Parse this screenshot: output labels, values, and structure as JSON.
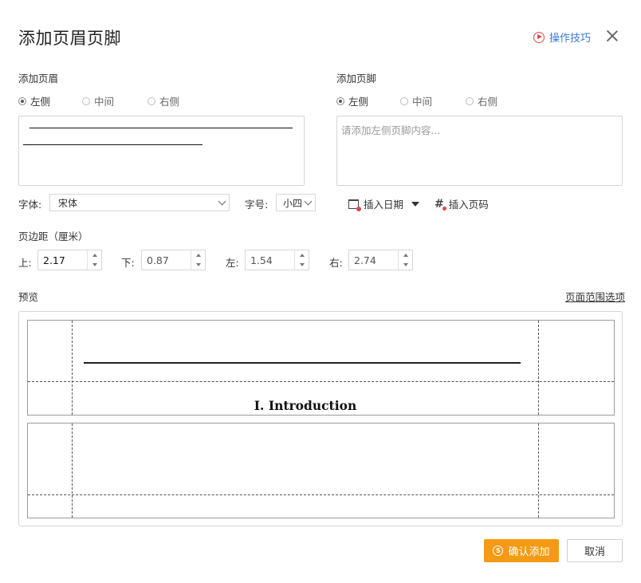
{
  "dialog": {
    "title": "添加页眉页脚",
    "tips_label": "操作技巧"
  },
  "header_section": {
    "label": "添加页眉",
    "positions": [
      "左侧",
      "中间",
      "右侧"
    ],
    "selected": "左侧"
  },
  "footer_section": {
    "label": "添加页脚",
    "positions": [
      "左侧",
      "中间",
      "右侧"
    ],
    "selected": "左侧",
    "placeholder": "请添加左侧页脚内容..."
  },
  "font": {
    "label": "字体:",
    "value": "宋体"
  },
  "font_size": {
    "label": "字号:",
    "value": "小四"
  },
  "toolbar": {
    "insert_date": "插入日期",
    "insert_page": "插入页码"
  },
  "margins": {
    "label": "页边距（厘米）",
    "top_label": "上:",
    "top_value": "2.17",
    "bottom_label": "下:",
    "bottom_value": "0.87",
    "left_label": "左:",
    "left_value": "1.54",
    "right_label": "右:",
    "right_value": "2.74"
  },
  "preview": {
    "label": "预览",
    "range_link": "页面范围选项",
    "header_line": "—————————————————————————————————————",
    "heading": "I. Introduction"
  },
  "buttons": {
    "confirm": "确认添加",
    "cancel": "取消"
  },
  "colors": {
    "accent": "#f59a14",
    "link": "#3b79d8",
    "icon_red": "#e0464a"
  }
}
